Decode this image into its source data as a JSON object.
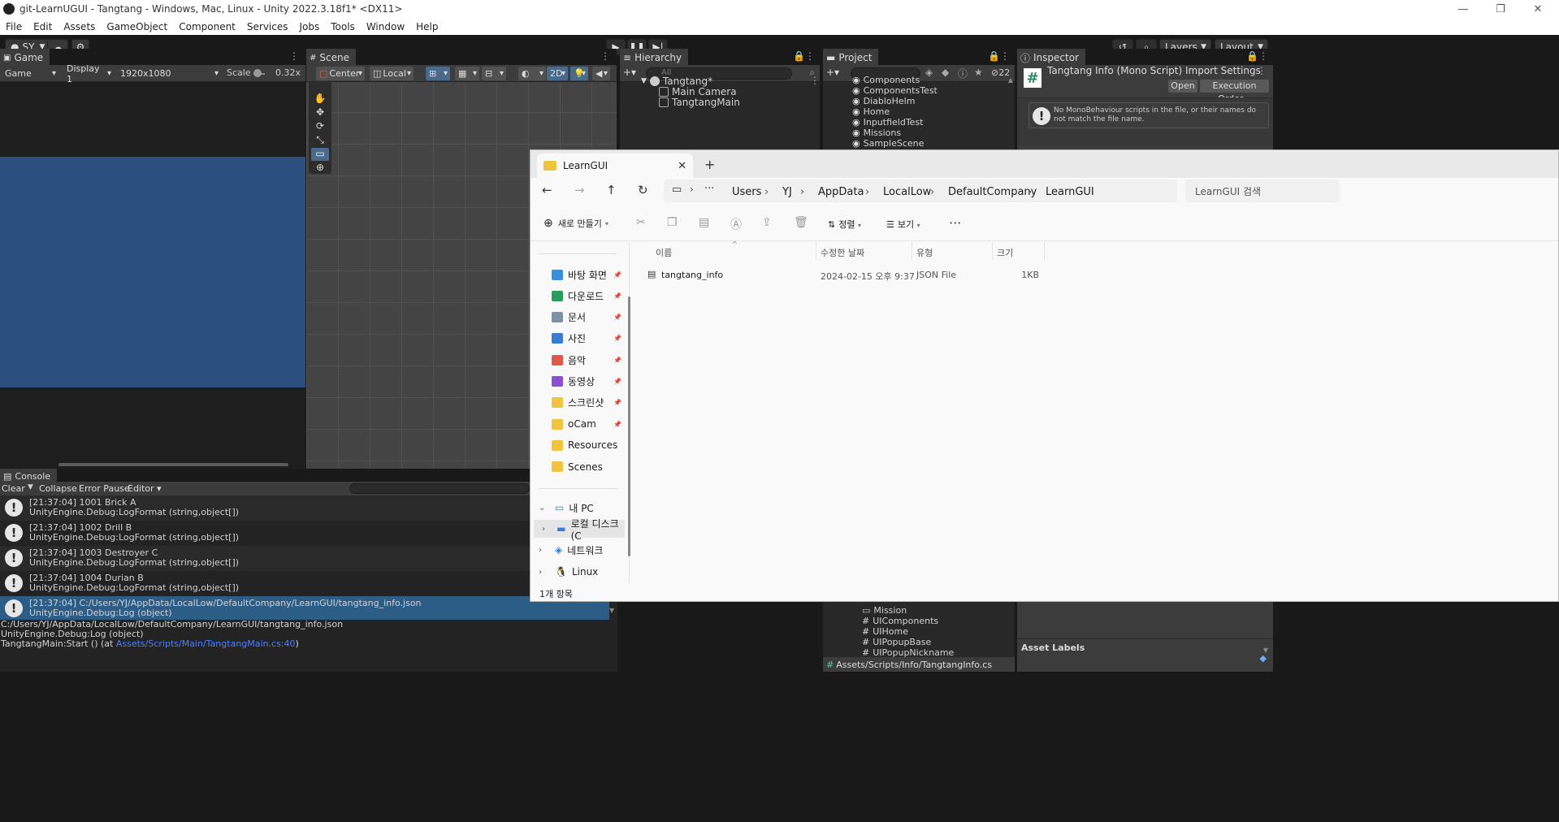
{
  "window": {
    "title": "git-LearnUGUI - Tangtang - Windows, Mac, Linux - Unity 2022.3.18f1* <DX11>",
    "controls": [
      "—",
      "❐",
      "✕"
    ]
  },
  "menu": [
    "File",
    "Edit",
    "Assets",
    "GameObject",
    "Component",
    "Services",
    "Jobs",
    "Tools",
    "Window",
    "Help"
  ],
  "toolbar": {
    "account": "SY",
    "layers": "Layers",
    "layout": "Layout"
  },
  "game": {
    "tab": "Game",
    "mode": "Game",
    "display": "Display 1",
    "resolution": "1920x1080",
    "scale_label": "Scale",
    "scale_value": "0.32x",
    "viewport_color": "#2b4f7f"
  },
  "scene": {
    "tab": "Scene",
    "pivot": "Center",
    "space": "Local",
    "mode_2d": "2D"
  },
  "hierarchy": {
    "tab": "Hierarchy",
    "search_placeholder": "All",
    "root": "Tangtang*",
    "children": [
      "Main Camera",
      "TangtangMain"
    ]
  },
  "project": {
    "tab": "Project",
    "hidden_count": "22",
    "scenes": [
      "Components",
      "ComponentsTest",
      "DiabloHelm",
      "Home",
      "InputfieldTest",
      "Missions",
      "SampleScene"
    ],
    "lower_items": [
      {
        "label": "Mission",
        "kind": "folder"
      },
      {
        "label": "UIComponents",
        "kind": "script"
      },
      {
        "label": "UIHome",
        "kind": "script"
      },
      {
        "label": "UIPopupBase",
        "kind": "script"
      },
      {
        "label": "UIPopupNickname",
        "kind": "script"
      }
    ],
    "path": "Assets/Scripts/Info/TangtangInfo.cs"
  },
  "inspector": {
    "tab": "Inspector",
    "title": "Tangtang Info (Mono Script) Import Settings",
    "open_label": "Open",
    "exec_order_label": "Execution Order...",
    "warning": "No MonoBehaviour scripts in the file, or their names do not match the file name.",
    "asset_labels": "Asset Labels"
  },
  "console": {
    "tab": "Console",
    "clear": "Clear",
    "collapse": "Collapse",
    "error_pause": "Error Pause",
    "editor": "Editor",
    "logs": [
      {
        "line1": "[21:37:04] 1001 Brick A",
        "line2": "UnityEngine.Debug:LogFormat (string,object[])"
      },
      {
        "line1": "[21:37:04] 1002 Drill B",
        "line2": "UnityEngine.Debug:LogFormat (string,object[])"
      },
      {
        "line1": "[21:37:04] 1003 Destroyer C",
        "line2": "UnityEngine.Debug:LogFormat (string,object[])"
      },
      {
        "line1": "[21:37:04] 1004 Durian B",
        "line2": "UnityEngine.Debug:LogFormat (string,object[])"
      },
      {
        "line1": "[21:37:04] C:/Users/YJ/AppData/LocalLow/DefaultCompany/LearnGUI/tangtang_info.json",
        "line2": "UnityEngine.Debug:Log (object)"
      }
    ],
    "detail": {
      "line1": "C:/Users/YJ/AppData/LocalLow/DefaultCompany/LearnGUI/tangtang_info.json",
      "line2": "UnityEngine.Debug:Log (object)",
      "line3_prefix": "TangtangMain:Start () (at ",
      "line3_link": "Assets/Scripts/Main/TangtangMain.cs:40",
      "line3_suffix": ")"
    }
  },
  "explorer": {
    "tab_title": "LearnGUI",
    "breadcrumb": [
      "Users",
      "YJ",
      "AppData",
      "LocalLow",
      "DefaultCompany",
      "LearnGUI"
    ],
    "search_placeholder": "LearnGUI 검색",
    "new_label": "새로 만들기",
    "sort_label": "정렬",
    "view_label": "보기",
    "columns": {
      "name": "이름",
      "modified": "수정한 날짜",
      "type": "유형",
      "size": "크기"
    },
    "files": [
      {
        "name": "tangtang_info",
        "modified": "2024-02-15 오후 9:37",
        "type": "JSON File",
        "size": "1KB"
      }
    ],
    "quick_access": [
      {
        "label": "바탕 화면",
        "color": "#3b8fd9"
      },
      {
        "label": "다운로드",
        "color": "#2a9d5c"
      },
      {
        "label": "문서",
        "color": "#7f8fa6"
      },
      {
        "label": "사진",
        "color": "#3a7bd5"
      },
      {
        "label": "음악",
        "color": "#e0584a"
      },
      {
        "label": "동영상",
        "color": "#8b4fd1"
      },
      {
        "label": "스크린샷",
        "color": "#f0c43c"
      },
      {
        "label": "oCam",
        "color": "#f0c43c"
      },
      {
        "label": "Resources",
        "color": "#f0c43c"
      },
      {
        "label": "Scenes",
        "color": "#f0c43c"
      }
    ],
    "tree": [
      {
        "label": "내 PC",
        "expanded": true
      },
      {
        "label": "로컬 디스크 (C",
        "selected": true
      },
      {
        "label": "네트워크"
      },
      {
        "label": "Linux"
      }
    ],
    "status": "1개 항목"
  }
}
